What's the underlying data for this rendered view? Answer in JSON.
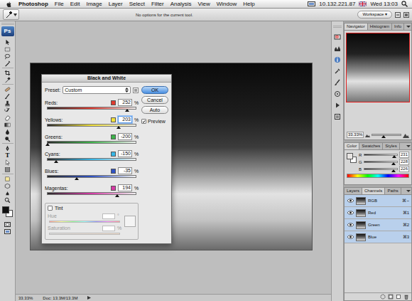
{
  "menubar": {
    "app": "Photoshop",
    "items": [
      "File",
      "Edit",
      "Image",
      "Layer",
      "Select",
      "Filter",
      "Analysis",
      "View",
      "Window",
      "Help"
    ],
    "ip": "10.132.221.87",
    "clock": "Wed 13:03"
  },
  "options_bar": {
    "message": "No options for the current tool.",
    "workspace": "Workspace ▾"
  },
  "toolbox": {
    "logo": "Ps",
    "type_tool": "T"
  },
  "dialog": {
    "title": "Black and White",
    "preset_label": "Preset:",
    "preset": "Custom",
    "channels": [
      {
        "name": "Reds:",
        "value": "252",
        "unit": "%",
        "level": 0.904,
        "color": "#e03a2f",
        "selected": false
      },
      {
        "name": "Yellows:",
        "value": "203",
        "unit": "%",
        "level": 0.806,
        "color": "#f2e13a",
        "selected": true
      },
      {
        "name": "Greens:",
        "value": "-200",
        "unit": "%",
        "level": 0,
        "color": "#3db34a",
        "selected": false
      },
      {
        "name": "Cyans:",
        "value": "-150",
        "unit": "%",
        "level": 0.1,
        "color": "#36b6e6",
        "selected": false
      },
      {
        "name": "Blues:",
        "value": "-35",
        "unit": "%",
        "level": 0.33,
        "color": "#2f52c4",
        "selected": false
      },
      {
        "name": "Magentas:",
        "value": "194",
        "unit": "%",
        "level": 0.788,
        "color": "#d63aa6",
        "selected": false
      }
    ],
    "buttons": [
      {
        "label": "OK",
        "default": true
      },
      {
        "label": "Cancel",
        "default": false
      },
      {
        "label": "Auto",
        "default": false
      }
    ],
    "preview": {
      "label": "Preview",
      "checked": true
    },
    "tint": {
      "label": "Tint",
      "checked": false,
      "disabled": true,
      "hue_label": "Hue",
      "hue_unit": "°",
      "saturation_label": "Saturation",
      "saturation_unit": "%"
    }
  },
  "navigator": {
    "tabs": [
      {
        "label": "Navigator",
        "selected": true
      },
      {
        "label": "Histogram",
        "selected": false
      },
      {
        "label": "Info",
        "selected": false
      }
    ],
    "zoom": "33.33%",
    "zoom_level": 0.4
  },
  "color_panel": {
    "tabs": [
      {
        "label": "Color",
        "selected": true
      },
      {
        "label": "Swatches",
        "selected": false
      },
      {
        "label": "Styles",
        "selected": false
      }
    ],
    "channels": [
      {
        "name": "R",
        "value": "231",
        "level": 0.906
      },
      {
        "name": "G",
        "value": "228",
        "level": 0.894
      },
      {
        "name": "B",
        "value": "226",
        "level": 0.886
      }
    ]
  },
  "channels_panel": {
    "tabs": [
      {
        "label": "Layers",
        "selected": false
      },
      {
        "label": "Channels",
        "selected": true
      },
      {
        "label": "Paths",
        "selected": false
      }
    ],
    "channels": [
      {
        "name": "RGB",
        "shortcut": "⌘~",
        "visible": true,
        "selected": true
      },
      {
        "name": "Red",
        "shortcut": "⌘1",
        "visible": true,
        "selected": true
      },
      {
        "name": "Green",
        "shortcut": "⌘2",
        "visible": true,
        "selected": true
      },
      {
        "name": "Blue",
        "shortcut": "⌘3",
        "visible": true,
        "selected": true
      }
    ]
  },
  "status_bar": {
    "zoom": "33.33%",
    "doc": "Doc: 13.3M/13.3M"
  }
}
